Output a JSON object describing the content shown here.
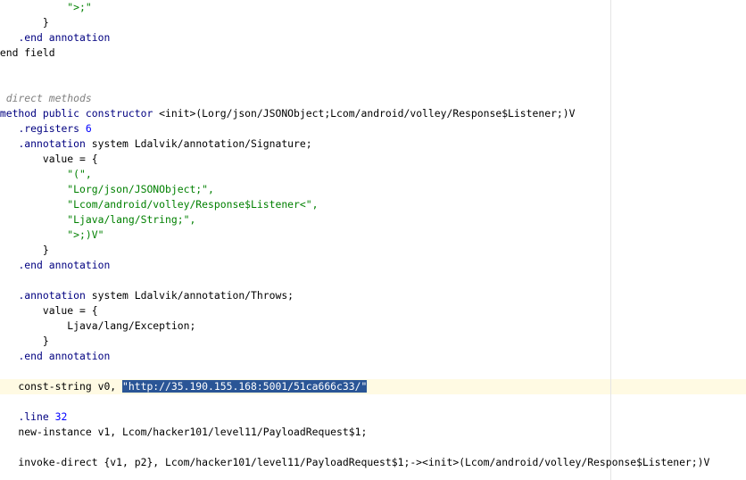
{
  "editor": {
    "lines": [
      [
        {
          "t": "            \">;\"",
          "c": "str"
        }
      ],
      [
        {
          "t": "        }",
          "c": "plain"
        }
      ],
      [
        {
          "t": "    ",
          "c": "plain"
        },
        {
          "t": ".end annotation",
          "c": "kw"
        }
      ],
      [
        {
          "t": ".end field",
          "c": "plain"
        }
      ],
      [],
      [],
      [
        {
          "t": "# direct methods",
          "c": "cmt"
        }
      ],
      [
        {
          "t": ".method public constructor",
          "c": "kw"
        },
        {
          "t": " <init>(Lorg/json/JSONObject;Lcom/android/volley/Response$Listener;)V",
          "c": "plain"
        }
      ],
      [
        {
          "t": "    ",
          "c": "plain"
        },
        {
          "t": ".registers",
          "c": "kw"
        },
        {
          "t": " ",
          "c": "plain"
        },
        {
          "t": "6",
          "c": "num"
        }
      ],
      [
        {
          "t": "    ",
          "c": "plain"
        },
        {
          "t": ".annotation",
          "c": "kw"
        },
        {
          "t": " system Ldalvik/annotation/Signature;",
          "c": "plain"
        }
      ],
      [
        {
          "t": "        value = {",
          "c": "plain"
        }
      ],
      [
        {
          "t": "            \"(\",",
          "c": "str"
        }
      ],
      [
        {
          "t": "            \"Lorg/json/JSONObject;\",",
          "c": "str"
        }
      ],
      [
        {
          "t": "            \"Lcom/android/volley/Response$Listener<\",",
          "c": "str"
        }
      ],
      [
        {
          "t": "            \"Ljava/lang/String;\",",
          "c": "str"
        }
      ],
      [
        {
          "t": "            \">;)V\"",
          "c": "str"
        }
      ],
      [
        {
          "t": "        }",
          "c": "plain"
        }
      ],
      [
        {
          "t": "    ",
          "c": "plain"
        },
        {
          "t": ".end annotation",
          "c": "kw"
        }
      ],
      [],
      [
        {
          "t": "    ",
          "c": "plain"
        },
        {
          "t": ".annotation",
          "c": "kw"
        },
        {
          "t": " system Ldalvik/annotation/Throws;",
          "c": "plain"
        }
      ],
      [
        {
          "t": "        value = {",
          "c": "plain"
        }
      ],
      [
        {
          "t": "            Ljava/lang/Exception;",
          "c": "plain"
        }
      ],
      [
        {
          "t": "        }",
          "c": "plain"
        }
      ],
      [
        {
          "t": "    ",
          "c": "plain"
        },
        {
          "t": ".end annotation",
          "c": "kw"
        }
      ],
      [],
      [
        {
          "t": "    const-string v0, ",
          "c": "plain"
        },
        {
          "t": "\"http://35.190.155.168:5001/51ca666c33/\"",
          "c": "sel"
        }
      ],
      [],
      [
        {
          "t": "    ",
          "c": "plain"
        },
        {
          "t": ".line",
          "c": "kw"
        },
        {
          "t": " ",
          "c": "plain"
        },
        {
          "t": "32",
          "c": "num"
        }
      ],
      [
        {
          "t": "    new-instance v1, Lcom/hacker101/level11/PayloadRequest$1;",
          "c": "plain"
        }
      ],
      [],
      [
        {
          "t": "    invoke-direct {v1, p2}, Lcom/hacker101/level11/PayloadRequest$1;-><init>(Lcom/android/volley/Response$Listener;)V",
          "c": "plain"
        }
      ]
    ]
  }
}
